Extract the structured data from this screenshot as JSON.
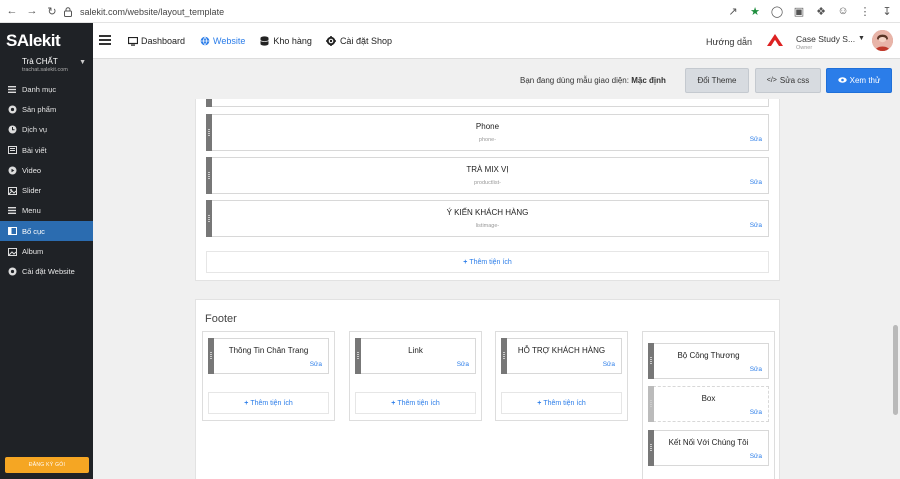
{
  "browser": {
    "url": "salekit.com/website/layout_template"
  },
  "sidebar": {
    "logo": "SAlekit",
    "store_name": "Trà CHẤT",
    "store_url": "trachat.salekit.com",
    "items": [
      {
        "label": "Danh mục",
        "icon": "list-icon"
      },
      {
        "label": "Sản phẩm",
        "icon": "gear-icon"
      },
      {
        "label": "Dịch vụ",
        "icon": "clock-icon"
      },
      {
        "label": "Bài viết",
        "icon": "article-icon"
      },
      {
        "label": "Video",
        "icon": "play-icon"
      },
      {
        "label": "Slider",
        "icon": "slider-icon"
      },
      {
        "label": "Menu",
        "icon": "menu-icon"
      },
      {
        "label": "Bố cục",
        "icon": "layout-icon"
      },
      {
        "label": "Album",
        "icon": "image-icon"
      },
      {
        "label": "Cài đặt Website",
        "icon": "settings-icon"
      }
    ],
    "active_index": 7,
    "promo_label": "ĐĂNG KÝ GÓI"
  },
  "header": {
    "nav": [
      {
        "label": "Dashboard",
        "icon": "monitor-icon"
      },
      {
        "label": "Website",
        "icon": "globe-icon"
      },
      {
        "label": "Kho hàng",
        "icon": "database-icon"
      },
      {
        "label": "Cài đặt Shop",
        "icon": "gear-icon"
      }
    ],
    "help": "Hướng dẫn",
    "account_name": "Case Study S...",
    "account_role": "Owner"
  },
  "theme": {
    "text_prefix": "Bạn đang dùng mẫu giao diện:",
    "theme_name": "Mặc định",
    "change_theme": "Đổi Theme",
    "edit_css": "Sửa css",
    "preview": "Xem thử"
  },
  "layout": {
    "widgets": [
      {
        "title": "Phone",
        "sub": "phone-",
        "edit": "Sửa"
      },
      {
        "title": "TRÀ MIX VỊ",
        "sub": "productlist-",
        "edit": "Sửa"
      },
      {
        "title": "Ý KIẾN KHÁCH HÀNG",
        "sub": "listimage-",
        "edit": "Sửa"
      }
    ],
    "add_widget": "Thêm tiện ích"
  },
  "footer": {
    "title": "Footer",
    "columns": [
      {
        "widgets": [
          {
            "title": "Thông Tin Chân Trang",
            "edit": "Sửa"
          }
        ],
        "add": "Thêm tiện ích"
      },
      {
        "widgets": [
          {
            "title": "Link",
            "edit": "Sửa"
          }
        ],
        "add": "Thêm tiện ích"
      },
      {
        "widgets": [
          {
            "title": "HỖ TRỢ KHÁCH HÀNG",
            "edit": "Sửa"
          }
        ],
        "add": "Thêm tiện ích"
      },
      {
        "widgets": [
          {
            "title": "Bộ Công Thương",
            "edit": "Sửa"
          },
          {
            "title": "Box",
            "edit": "Sửa"
          },
          {
            "title": "Kết Nối Với Chúng Tôi",
            "edit": "Sửa"
          }
        ]
      }
    ]
  }
}
